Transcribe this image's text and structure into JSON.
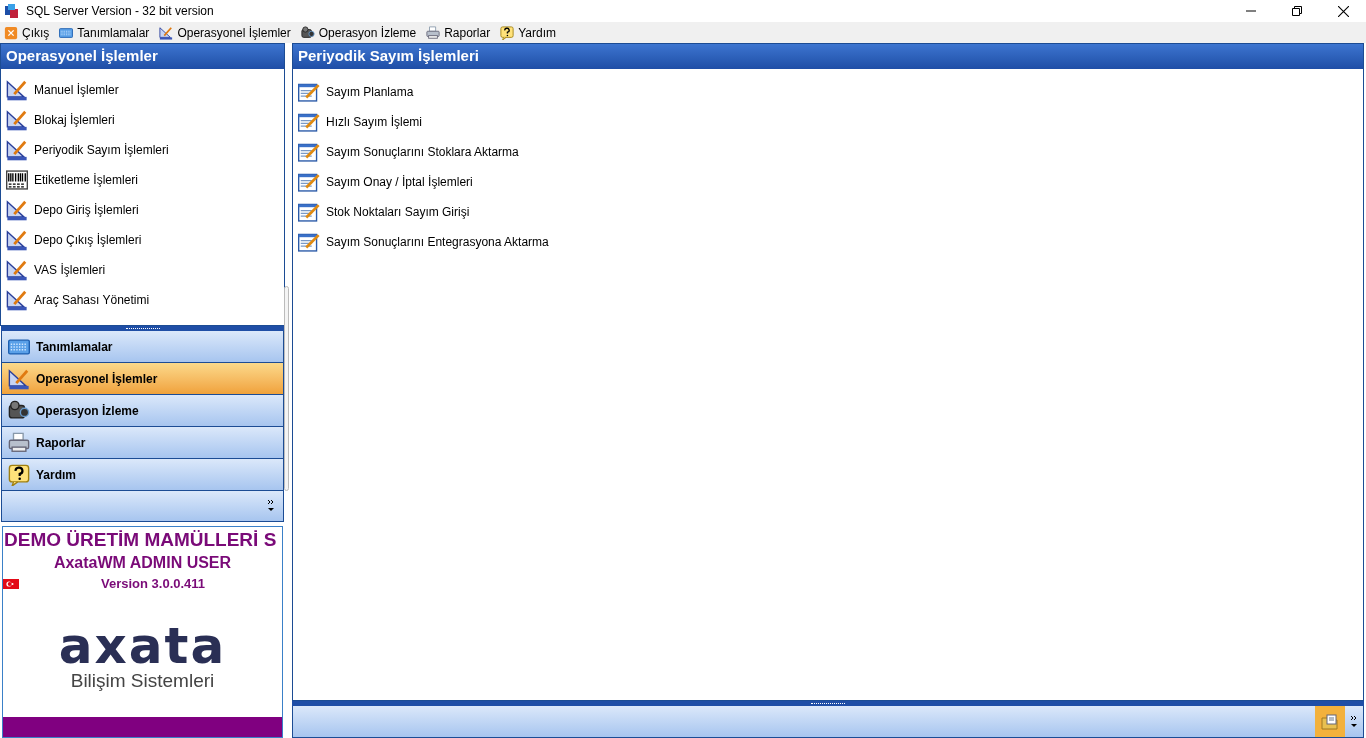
{
  "window": {
    "title": "SQL Server Version - 32 bit version"
  },
  "menu": [
    {
      "label": "Çıkış",
      "kind": "exit"
    },
    {
      "label": "Tanımlamalar",
      "kind": "keyboard"
    },
    {
      "label": "Operasyonel İşlemler",
      "kind": "ruler"
    },
    {
      "label": "Operasyon İzleme",
      "kind": "camera"
    },
    {
      "label": "Raporlar",
      "kind": "printer"
    },
    {
      "label": "Yardım",
      "kind": "help"
    }
  ],
  "left_panel": {
    "title": "Operasyonel İşlemler",
    "items": [
      {
        "label": "Manuel İşlemler",
        "kind": "ruler"
      },
      {
        "label": "Blokaj İşlemleri",
        "kind": "ruler"
      },
      {
        "label": "Periyodik Sayım İşlemleri",
        "kind": "ruler"
      },
      {
        "label": "Etiketleme İşlemleri",
        "kind": "barcode"
      },
      {
        "label": "Depo Giriş İşlemleri",
        "kind": "ruler"
      },
      {
        "label": "Depo Çıkış İşlemleri",
        "kind": "ruler"
      },
      {
        "label": "VAS İşlemleri",
        "kind": "ruler"
      },
      {
        "label": "Araç Sahası Yönetimi",
        "kind": "ruler"
      }
    ]
  },
  "nav_buttons": [
    {
      "label": "Tanımlamalar",
      "kind": "keyboard",
      "selected": false
    },
    {
      "label": "Operasyonel İşlemler",
      "kind": "ruler",
      "selected": true
    },
    {
      "label": "Operasyon İzleme",
      "kind": "camera",
      "selected": false
    },
    {
      "label": "Raporlar",
      "kind": "printer",
      "selected": false
    },
    {
      "label": "Yardım",
      "kind": "help",
      "selected": false
    }
  ],
  "info": {
    "company": "DEMO ÜRETİM MAMÜLLERİ S",
    "user": "AxataWM ADMIN USER",
    "version": "Version 3.0.0.411",
    "logo": "axata",
    "logo_subtitle": "Bilişim Sistemleri"
  },
  "right_panel": {
    "title": "Periyodik Sayım İşlemleri",
    "items": [
      {
        "label": "Sayım Planlama"
      },
      {
        "label": "Hızlı Sayım İşlemi"
      },
      {
        "label": "Sayım Sonuçlarını Stoklara Aktarma"
      },
      {
        "label": "Sayım Onay / İptal İşlemleri"
      },
      {
        "label": "Stok Noktaları Sayım Girişi"
      },
      {
        "label": "Sayım Sonuçlarını Entegrasyona Aktarma"
      }
    ]
  }
}
